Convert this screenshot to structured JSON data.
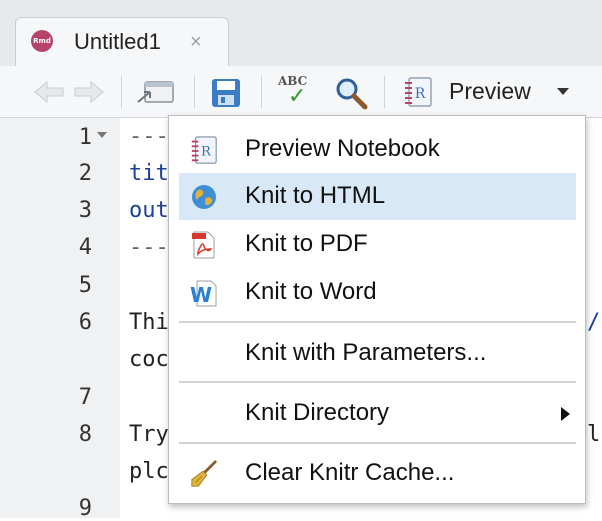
{
  "tab": {
    "title": "Untitled1",
    "icon_text": "Rmd",
    "close_icon": "×"
  },
  "toolbar": {
    "spellcheck_abc": "ABC",
    "spellcheck_check": "✓",
    "preview_r_glyph": "R",
    "preview_label": "Preview"
  },
  "editor": {
    "line_numbers": [
      "1",
      "2",
      "3",
      "4",
      "5",
      "6",
      "7",
      "8",
      "9"
    ],
    "lines": [
      "---",
      "tit",
      "out",
      "---",
      "",
      "Thi",
      "coc",
      "",
      "Try",
      "plc",
      ""
    ],
    "right_fragments": [
      "/",
      "l"
    ]
  },
  "menu": {
    "items": [
      {
        "label": "Preview Notebook",
        "icon": "notebook-icon",
        "glyph": "R"
      },
      {
        "label": "Knit to HTML",
        "icon": "globe-icon"
      },
      {
        "label": "Knit to PDF",
        "icon": "pdf-icon"
      },
      {
        "label": "Knit to Word",
        "icon": "word-icon",
        "glyph": "W"
      },
      {
        "label": "Knit with Parameters...",
        "icon": ""
      },
      {
        "label": "Knit Directory",
        "icon": ""
      },
      {
        "label": "Clear Knitr Cache...",
        "icon": "broom-icon"
      }
    ],
    "highlighted_index": 1
  },
  "colors": {
    "accent_highlight": "#d8e8f7",
    "rmd_badge": "#b6446a",
    "code_blue": "#1d3e9c"
  }
}
